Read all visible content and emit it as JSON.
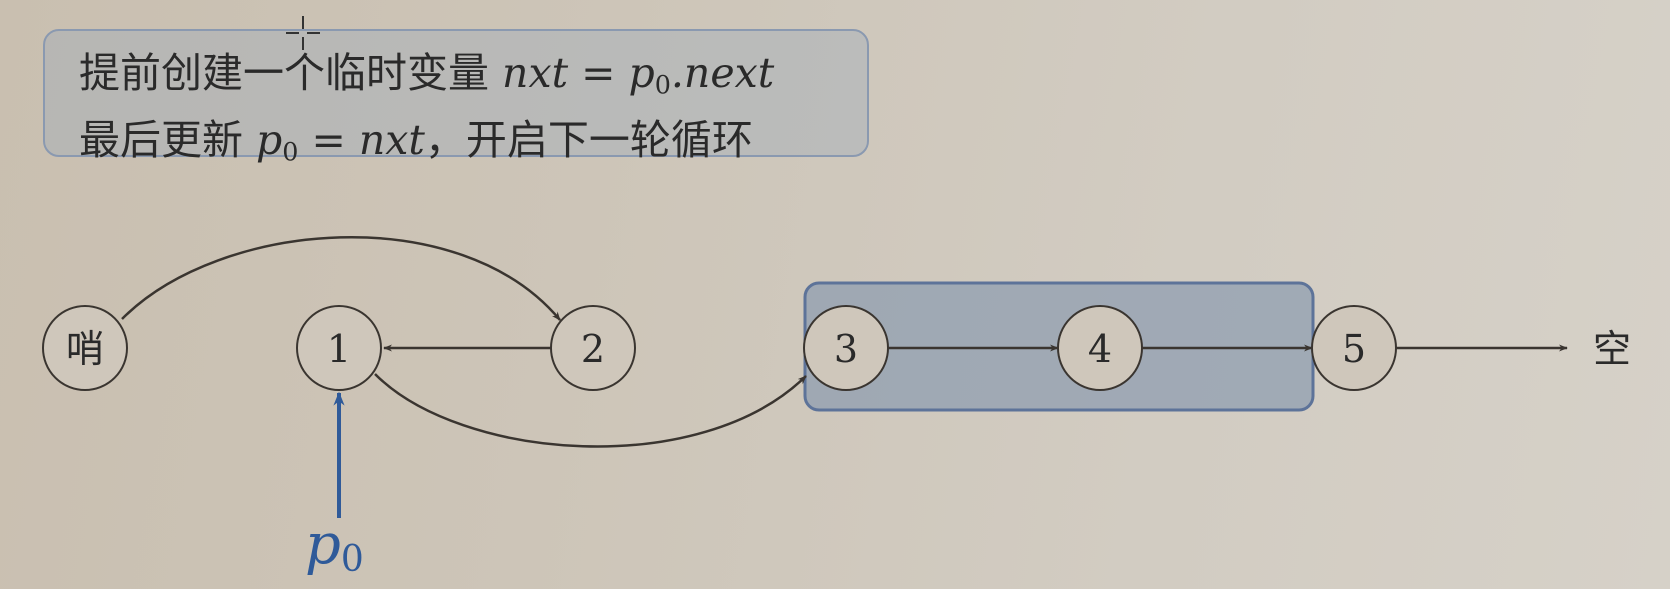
{
  "note": {
    "line1_text": "提前创建一个临时变量 ",
    "line1_math": "nxt = p",
    "line1_sub": "0",
    "line1_math_tail": ".next",
    "line2_text": "最后更新 ",
    "line2_math": "p",
    "line2_sub": "0",
    "line2_math_tail": " = nxt",
    "line2_tail": "，开启下一轮循环"
  },
  "diagram": {
    "nodes": [
      "哨",
      "1",
      "2",
      "3",
      "4",
      "5"
    ],
    "null_label": "空",
    "pointer_label": "p",
    "pointer_sub": "0"
  },
  "colors": {
    "node_fill": "#cfc7bb",
    "node_stroke": "#3a3530",
    "edge": "#3a3530",
    "highlight_fill": "#8f9db0",
    "highlight_stroke": "#5d7399",
    "pointer": "#2f5a99"
  }
}
